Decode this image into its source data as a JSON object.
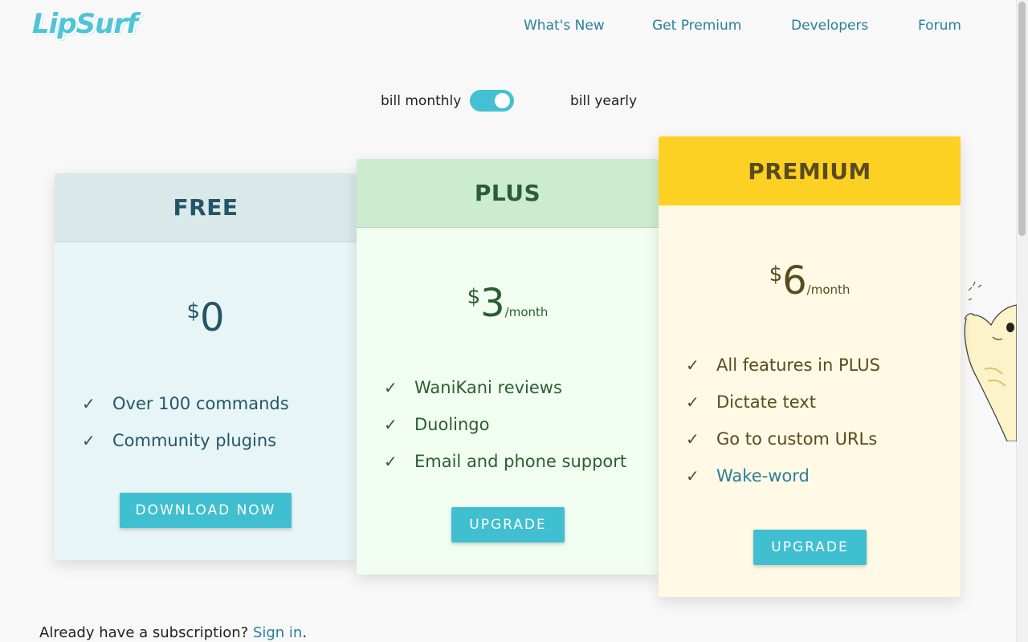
{
  "brand": {
    "logo_text": "LipSurf",
    "accent": "#43c1d2",
    "link_color": "#2a7f9b"
  },
  "nav": [
    {
      "label": "What's New"
    },
    {
      "label": "Get Premium"
    },
    {
      "label": "Developers"
    },
    {
      "label": "Forum"
    }
  ],
  "billing_toggle": {
    "left_label": "bill monthly",
    "right_label": "bill yearly",
    "state": "on"
  },
  "plans": {
    "free": {
      "name": "FREE",
      "currency": "$",
      "amount": "0",
      "period": "",
      "features": [
        "Over 100 commands",
        "Community plugins"
      ],
      "button": "DOWNLOAD NOW",
      "color": "#e8f5f7"
    },
    "plus": {
      "name": "PLUS",
      "currency": "$",
      "amount": "3",
      "period": "/month",
      "features": [
        "WaniKani reviews",
        "Duolingo",
        "Email and phone support"
      ],
      "button": "UPGRADE",
      "color": "#f1fdf1"
    },
    "premium": {
      "name": "PREMIUM",
      "currency": "$",
      "amount": "6",
      "period": "/month",
      "features": [
        "All features in PLUS",
        "Dictate text",
        "Go to custom URLs",
        "Wake-word"
      ],
      "button": "UPGRADE",
      "color": "#fdd123"
    }
  },
  "footer": {
    "text": "Already have a subscription?",
    "link": "Sign in",
    "trailing": "."
  },
  "icons": {
    "check": "check-icon",
    "mascot": "cat-mascot"
  }
}
